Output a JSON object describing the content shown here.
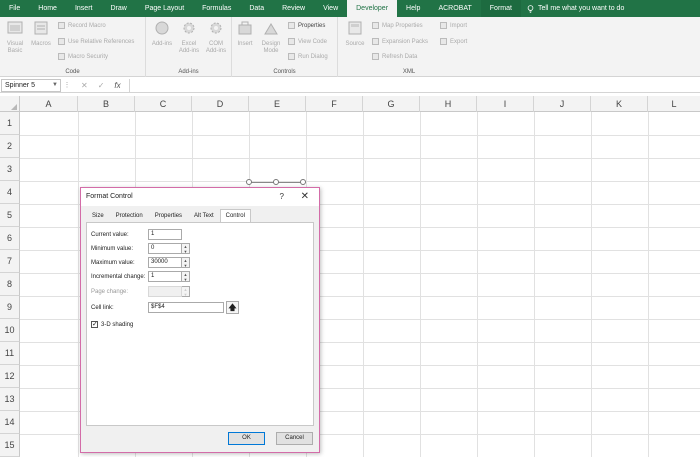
{
  "tabs": [
    "File",
    "Home",
    "Insert",
    "Draw",
    "Page Layout",
    "Formulas",
    "Data",
    "Review",
    "View",
    "Developer",
    "Help",
    "ACROBAT",
    "Format"
  ],
  "active_tab": "Developer",
  "tell_me": "Tell me what you want to do",
  "ribbon": {
    "code": {
      "label": "Code",
      "visual_basic": "Visual Basic",
      "macros": "Macros",
      "record_macro": "Record Macro",
      "use_relative": "Use Relative References",
      "macro_security": "Macro Security"
    },
    "addins": {
      "label": "Add-ins",
      "addins": "Add-ins",
      "excel_addins": "Excel Add-ins",
      "com_addins": "COM Add-ins"
    },
    "controls": {
      "label": "Controls",
      "insert": "Insert",
      "design_mode": "Design Mode",
      "properties": "Properties",
      "view_code": "View Code",
      "run_dialog": "Run Dialog"
    },
    "xml": {
      "label": "XML",
      "source": "Source",
      "map_properties": "Map Properties",
      "expansion_packs": "Expansion Packs",
      "refresh_data": "Refresh Data",
      "import": "Import",
      "export": "Export"
    }
  },
  "formula_bar": {
    "name_box": "Spinner 5",
    "fx": "fx",
    "value": ""
  },
  "grid": {
    "columns": [
      "A",
      "B",
      "C",
      "D",
      "E",
      "F",
      "G",
      "H",
      "I",
      "J",
      "K",
      "L"
    ],
    "rows": [
      "1",
      "2",
      "3",
      "4",
      "5",
      "6",
      "7",
      "8",
      "9",
      "10",
      "11",
      "12",
      "13",
      "14",
      "15"
    ]
  },
  "dialog": {
    "title": "Format Control",
    "help": "?",
    "close": "✕",
    "tabs": [
      "Size",
      "Protection",
      "Properties",
      "Alt Text",
      "Control"
    ],
    "active_tab": "Control",
    "fields": {
      "current_value": {
        "label": "Current value:",
        "value": "1"
      },
      "minimum_value": {
        "label": "Minimum value:",
        "value": "0"
      },
      "maximum_value": {
        "label": "Maximum value:",
        "value": "30000"
      },
      "incremental_change": {
        "label": "Incremental change:",
        "value": "1"
      },
      "page_change": {
        "label": "Page change:",
        "value": ""
      },
      "cell_link": {
        "label": "Cell link:",
        "value": "$F$4"
      }
    },
    "shading_label": "3-D shading",
    "shading_checked": true,
    "ok": "OK",
    "cancel": "Cancel"
  }
}
